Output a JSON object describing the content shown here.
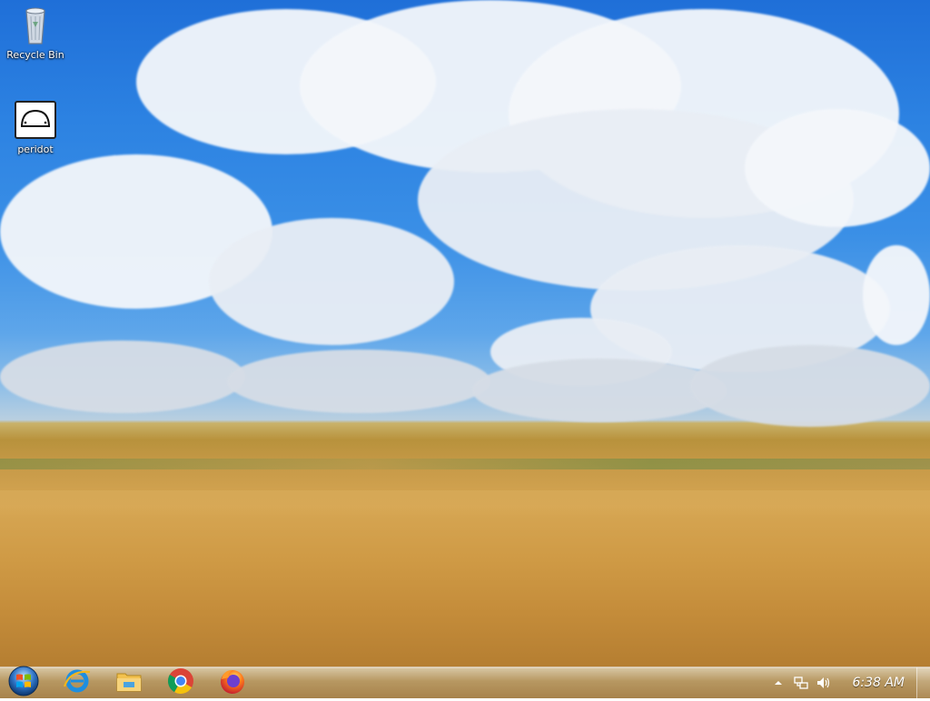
{
  "desktop": {
    "icons": [
      {
        "label": "Recycle Bin",
        "icon": "recycle-bin-icon"
      },
      {
        "label": "peridot",
        "icon": "drive-icon"
      }
    ],
    "wallpaper": "sky-and-wheat-field"
  },
  "taskbar": {
    "start": {
      "icon": "windows-start-icon"
    },
    "pinned": [
      {
        "name": "Internet Explorer",
        "icon": "internet-explorer-icon"
      },
      {
        "name": "File Explorer",
        "icon": "file-explorer-icon"
      },
      {
        "name": "Google Chrome",
        "icon": "chrome-icon"
      },
      {
        "name": "Firefox",
        "icon": "firefox-icon"
      }
    ],
    "tray": {
      "icons": [
        "show-hidden-icons-icon",
        "network-icon",
        "volume-icon"
      ],
      "clock": "6:38 AM"
    },
    "colors": {
      "accent": "#b08840"
    }
  }
}
